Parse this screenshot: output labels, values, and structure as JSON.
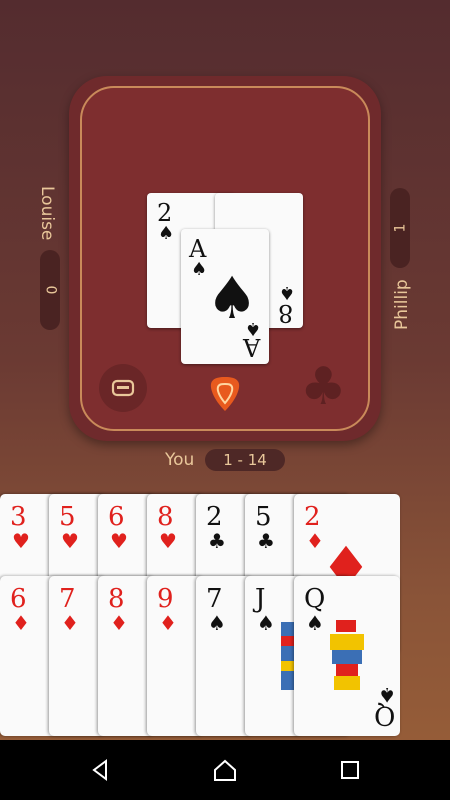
{
  "players": {
    "left": {
      "name": "Louise",
      "score": "0"
    },
    "right": {
      "name": "Phillip",
      "score": "1"
    },
    "you": {
      "name": "You",
      "score": "1 - 14"
    }
  },
  "table_cards": [
    {
      "rank": "2",
      "suit": "♠",
      "color": "black"
    },
    {
      "rank": "8",
      "suit": "♠",
      "color": "black"
    },
    {
      "rank": "A",
      "suit": "♠",
      "color": "black"
    }
  ],
  "hand_top_row": [
    {
      "rank": "3",
      "suit": "♥",
      "color": "red"
    },
    {
      "rank": "5",
      "suit": "♥",
      "color": "red"
    },
    {
      "rank": "6",
      "suit": "♥",
      "color": "red"
    },
    {
      "rank": "8",
      "suit": "♥",
      "color": "red"
    },
    {
      "rank": "2",
      "suit": "♣",
      "color": "black"
    },
    {
      "rank": "5",
      "suit": "♣",
      "color": "black"
    },
    {
      "rank": "2",
      "suit": "♦",
      "color": "red"
    }
  ],
  "hand_bottom_row": [
    {
      "rank": "6",
      "suit": "♦",
      "color": "red"
    },
    {
      "rank": "7",
      "suit": "♦",
      "color": "red"
    },
    {
      "rank": "8",
      "suit": "♦",
      "color": "red"
    },
    {
      "rank": "9",
      "suit": "♦",
      "color": "red"
    },
    {
      "rank": "7",
      "suit": "♠",
      "color": "black"
    },
    {
      "rank": "J",
      "suit": "♠",
      "color": "black"
    },
    {
      "rank": "Q",
      "suit": "♠",
      "color": "black"
    }
  ],
  "trump_suit_icon": "club-icon",
  "colors": {
    "table": "#7e2e2f",
    "accent": "#e9c79a",
    "red_suit": "#e0211d"
  }
}
